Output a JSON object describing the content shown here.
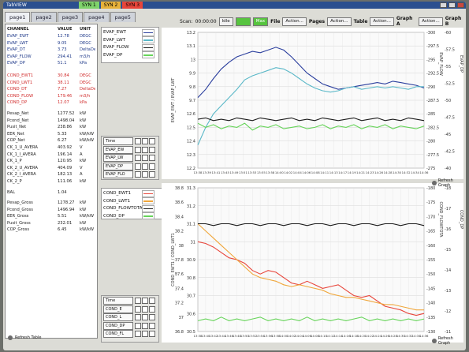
{
  "window": {
    "title": "TabVIEW"
  },
  "syn_tabs": [
    {
      "label": "SYN 1",
      "color": "#7fd36b"
    },
    {
      "label": "SYN 2",
      "color": "#e6b13a"
    },
    {
      "label": "SYN 3",
      "color": "#e8453a"
    }
  ],
  "page_tabs": [
    "page1",
    "page2",
    "page3",
    "page4",
    "page5"
  ],
  "toolbar": {
    "scan_label": "Scan:",
    "scan_time": "00:00:00",
    "idle_btn": "Idle",
    "run_btn": "",
    "max_btn": "Max",
    "file_label": "File",
    "pages_label": "Pages",
    "table_label": "Table",
    "grapha_label": "Graph A",
    "graphb_label": "Graph B",
    "action_label": "Action..."
  },
  "table": {
    "headers": [
      "CHANNEL",
      "VALUE",
      "UNIT"
    ],
    "evap_rows": [
      {
        "name": "EVAP_EWT",
        "value": "12.78",
        "unit": "DEGC"
      },
      {
        "name": "EVAP_LWT",
        "value": "9.05",
        "unit": "DEGC"
      },
      {
        "name": "EVAP_DT",
        "value": "3.73",
        "unit": "DeltaDeg"
      },
      {
        "name": "EVAP_FLOW",
        "value": "294.41",
        "unit": "m3/h"
      },
      {
        "name": "EVAP_DP",
        "value": "51.1",
        "unit": "kPa"
      }
    ],
    "cond_rows": [
      {
        "name": "COND_EWT1",
        "value": "30.84",
        "unit": "DEGC"
      },
      {
        "name": "COND_LWT1",
        "value": "38.11",
        "unit": "DEGC"
      },
      {
        "name": "COND_DT",
        "value": "7.27",
        "unit": "DeltaDeg"
      },
      {
        "name": "COND_FLOW",
        "value": "179.46",
        "unit": "m3/h"
      },
      {
        "name": "COND_DP",
        "value": "12.07",
        "unit": "kPa"
      }
    ],
    "net_rows": [
      {
        "name": "Pevap_Net",
        "value": "1277.52",
        "unit": "kW"
      },
      {
        "name": "Pcond_Net",
        "value": "1498.04",
        "unit": "kW"
      },
      {
        "name": "Pusit_Net",
        "value": "238.86",
        "unit": "kW"
      },
      {
        "name": "EER_Net",
        "value": "5.33",
        "unit": "kW/kW"
      },
      {
        "name": "COP_Net",
        "value": "6.27",
        "unit": "kW/kW"
      }
    ],
    "ck_rows": [
      {
        "name": "CK_1_U_AVERA",
        "value": "403.92",
        "unit": "V"
      },
      {
        "name": "CK_1_I_AVERA",
        "value": "196.14",
        "unit": "A"
      },
      {
        "name": "CK_1_P",
        "value": "120.95",
        "unit": "kW"
      },
      {
        "name": "CK_2_U_AVERA",
        "value": "404.09",
        "unit": "V"
      },
      {
        "name": "CK_2_I_AVERA",
        "value": "182.13",
        "unit": "A"
      },
      {
        "name": "CK_2_P",
        "value": "111.06",
        "unit": "kW"
      }
    ],
    "bal_row": {
      "name": "BAL",
      "value": "1.04",
      "unit": ""
    },
    "gross_rows": [
      {
        "name": "Pevap_Gross",
        "value": "1278.27",
        "unit": "kW"
      },
      {
        "name": "Pcond_Gross",
        "value": "1496.94",
        "unit": "kW"
      },
      {
        "name": "EER_Gross",
        "value": "5.51",
        "unit": "kW/kW"
      },
      {
        "name": "Pusit_Gross",
        "value": "232.01",
        "unit": "kW"
      },
      {
        "name": "COP_Gross",
        "value": "6.45",
        "unit": "kW/kW"
      }
    ],
    "refresh_label": "Refresh Table"
  },
  "evap_legend": [
    {
      "label": "EVAP_EWT",
      "color": "#2b3f9e"
    },
    {
      "label": "EVAP_LWT",
      "color": "#5ab8c8"
    },
    {
      "label": "EVAP_FLOW",
      "color": "#1a1a1a"
    },
    {
      "label": "EVAP_DP",
      "color": "#67d45a"
    }
  ],
  "evap_controls": {
    "time_label": "Time",
    "rows": [
      "EVAP_EW",
      "EVAP_LW",
      "EVAP_DP",
      "EVAP_FLO"
    ]
  },
  "cond_legend": [
    {
      "label": "COND_EWT1",
      "color": "#e8453a"
    },
    {
      "label": "COND_LWT1",
      "color": "#f0a63a"
    },
    {
      "label": "COND_FLOWTOTA",
      "color": "#1a1a1a"
    },
    {
      "label": "COND_DP",
      "color": "#67d45a"
    }
  ],
  "cond_controls": {
    "time_label": "Time",
    "rows": [
      "COND_E",
      "COND_L",
      "COND_DP",
      "COND_FL"
    ]
  },
  "graph_refresh": {
    "a": "Refresh Graph",
    "b": "Refresh Graph"
  },
  "chart_data": [
    {
      "type": "line",
      "title": "",
      "xlabel": "",
      "ylabel_left": "EVAP_EWT / EVAP_LWT",
      "ylabel_right_a": "EVAP_FLOW",
      "ylabel_right_b": "EVAP_DP",
      "ylim_left": [
        12.2,
        13.2
      ],
      "ylim_right_a": [
        300,
        275
      ],
      "ylim_right_b": [
        60,
        40
      ],
      "ticks_left": [
        "13.2",
        "13.1",
        "13",
        "12.9",
        "12.8",
        "12.7",
        "12.6",
        "12.5",
        "12.4",
        "12.3",
        "12.2"
      ],
      "tick_labels_left": [
        "13.2",
        "13.1",
        "13",
        "9.9",
        "9.8",
        "9.7",
        "12.6",
        "12.5",
        "12.4",
        "12.3",
        "12.2"
      ],
      "tick_labels_right_a": [
        "-300",
        "-297.5",
        "-295",
        "-292.5",
        "-290",
        "-287.5",
        "-285",
        "-282.5",
        "-280",
        "-277.5",
        "-275"
      ],
      "tick_labels_right_b": [
        "-60",
        "-57.5",
        "-55",
        "-52.5",
        "-50",
        "-47.5",
        "-45",
        "-42.5",
        "-40"
      ],
      "x": [
        "13:38",
        "13:40",
        "13:42",
        "13:44",
        "13:46",
        "13:48",
        "13:50",
        "13:52",
        "13:54",
        "13:56",
        "13:58",
        "14:00",
        "14:02",
        "14:04",
        "14:06",
        "14:08",
        "14:10",
        "14:12",
        "14:14",
        "14:16",
        "14:18",
        "14:20",
        "14:22",
        "14:24",
        "14:26",
        "14:28",
        "14:30",
        "14:32",
        "14:34",
        "14:36"
      ],
      "x_tick_labels": [
        "13:38",
        "13:39",
        "13:41",
        "13:45",
        "13:49",
        "13:51",
        "13:53",
        "13:55",
        "13:58",
        "14:00",
        "14:02",
        "14:04",
        "14:06",
        "14:08",
        "14:11",
        "14:13",
        "14:17",
        "14:19",
        "14:21",
        "14:23",
        "14:26",
        "14:28",
        "14:30",
        "14:32",
        "14:34",
        "14:36"
      ],
      "series": [
        {
          "name": "EVAP_EWT",
          "color": "#2b3f9e",
          "values": [
            12.72,
            12.78,
            12.86,
            12.93,
            12.98,
            13.02,
            13.04,
            13.06,
            13.05,
            13.07,
            13.09,
            13.07,
            13.02,
            12.96,
            12.9,
            12.86,
            12.82,
            12.8,
            12.78,
            12.79,
            12.8,
            12.81,
            12.82,
            12.83,
            12.82,
            12.84,
            12.83,
            12.82,
            12.81,
            12.79
          ]
        },
        {
          "name": "EVAP_LWT",
          "color": "#5ab8c8",
          "values": [
            12.37,
            12.5,
            12.6,
            12.66,
            12.72,
            12.78,
            12.85,
            12.88,
            12.9,
            12.92,
            12.94,
            12.93,
            12.9,
            12.86,
            12.82,
            12.79,
            12.77,
            12.76,
            12.77,
            12.79,
            12.8,
            12.78,
            12.79,
            12.8,
            12.79,
            12.8,
            12.79,
            12.78,
            12.8,
            12.8
          ]
        },
        {
          "name": "EVAP_FLOW",
          "color": "#1a1a1a",
          "values": [
            12.56,
            12.57,
            12.55,
            12.56,
            12.55,
            12.57,
            12.56,
            12.55,
            12.57,
            12.56,
            12.55,
            12.56,
            12.57,
            12.55,
            12.56,
            12.55,
            12.57,
            12.56,
            12.55,
            12.56,
            12.57,
            12.55,
            12.56,
            12.57,
            12.55,
            12.56,
            12.55,
            12.57,
            12.56,
            12.55
          ]
        },
        {
          "name": "EVAP_DP",
          "color": "#67d45a",
          "values": [
            12.53,
            12.5,
            12.52,
            12.49,
            12.51,
            12.5,
            12.53,
            12.48,
            12.51,
            12.5,
            12.52,
            12.49,
            12.5,
            12.51,
            12.49,
            12.5,
            12.52,
            12.49,
            12.51,
            12.5,
            12.52,
            12.49,
            12.51,
            12.5,
            12.52,
            12.49,
            12.51,
            12.5,
            12.49,
            12.51
          ]
        }
      ]
    },
    {
      "type": "line",
      "title": "",
      "xlabel": "",
      "ylabel_left": "COND_EWT1 / COND_LWT1",
      "ylabel_right_a": "COND_FLOWTOTA",
      "ylabel_right_b": "COND_DP",
      "ylim_left": [
        30.5,
        31.3
      ],
      "tick_labels_left": [
        "31.3",
        "31.2",
        "31.1",
        "31",
        "30.9",
        "30.8",
        "30.7",
        "30.6",
        "30.5"
      ],
      "tick_labels_left_b": [
        "38.8",
        "38.6",
        "38.4",
        "38.2",
        "38",
        "37.8",
        "37.6",
        "37.4",
        "37.2",
        "37",
        "36.8"
      ],
      "tick_labels_right_a": [
        "-180",
        "-175",
        "-170",
        "-165",
        "-160",
        "-155",
        "-150",
        "-145",
        "-140",
        "-135",
        "-130"
      ],
      "tick_labels_right_b": [
        "-18",
        "-17",
        "-16",
        "-15",
        "-14",
        "-13",
        "-12",
        "-11"
      ],
      "x_tick_labels": [
        "13:38",
        "13:40",
        "13:42",
        "13:44",
        "13:46",
        "13:48",
        "13:50",
        "13:52",
        "13:54",
        "13:56",
        "13:58",
        "14:00",
        "14:02",
        "14:04",
        "14:06",
        "14:08",
        "14:10",
        "14:12",
        "14:14",
        "14:16",
        "14:18",
        "14:20",
        "14:22",
        "14:24",
        "14:26",
        "14:28",
        "14:30",
        "14:32",
        "14:34",
        "14:36"
      ],
      "series": [
        {
          "name": "COND_EWT1",
          "color": "#e8453a",
          "values": [
            31.0,
            30.99,
            30.97,
            30.94,
            30.91,
            30.9,
            30.88,
            30.84,
            30.82,
            30.84,
            30.83,
            30.8,
            30.77,
            30.76,
            30.78,
            30.76,
            30.74,
            30.75,
            30.76,
            30.73,
            30.7,
            30.69,
            30.7,
            30.67,
            30.64,
            30.63,
            30.62,
            30.6,
            30.59,
            30.6
          ]
        },
        {
          "name": "COND_LWT1",
          "color": "#f0a63a",
          "values": [
            31.1,
            31.06,
            31.02,
            30.98,
            30.94,
            30.9,
            30.86,
            30.82,
            30.8,
            30.79,
            30.78,
            30.76,
            30.75,
            30.76,
            30.75,
            30.74,
            30.73,
            30.71,
            30.7,
            30.69,
            30.69,
            30.68,
            30.67,
            30.66,
            30.65,
            30.65,
            30.64,
            30.63,
            30.62,
            30.62
          ]
        },
        {
          "name": "COND_FLOWTOTA",
          "color": "#1a1a1a",
          "values": [
            31.1,
            31.1,
            31.09,
            31.1,
            31.1,
            31.09,
            31.1,
            31.1,
            31.09,
            31.1,
            31.1,
            31.09,
            31.1,
            31.1,
            31.09,
            31.1,
            31.1,
            31.09,
            31.1,
            31.1,
            31.09,
            31.1,
            31.1,
            31.09,
            31.1,
            31.1,
            31.09,
            31.1,
            31.1,
            31.09
          ]
        },
        {
          "name": "COND_DP",
          "color": "#67d45a",
          "values": [
            30.56,
            30.57,
            30.56,
            30.58,
            30.56,
            30.57,
            30.56,
            30.57,
            30.58,
            30.56,
            30.57,
            30.56,
            30.57,
            30.56,
            30.58,
            30.56,
            30.57,
            30.56,
            30.57,
            30.56,
            30.57,
            30.58,
            30.56,
            30.57,
            30.56,
            30.57,
            30.56,
            30.57,
            30.56,
            30.57
          ]
        }
      ]
    }
  ]
}
